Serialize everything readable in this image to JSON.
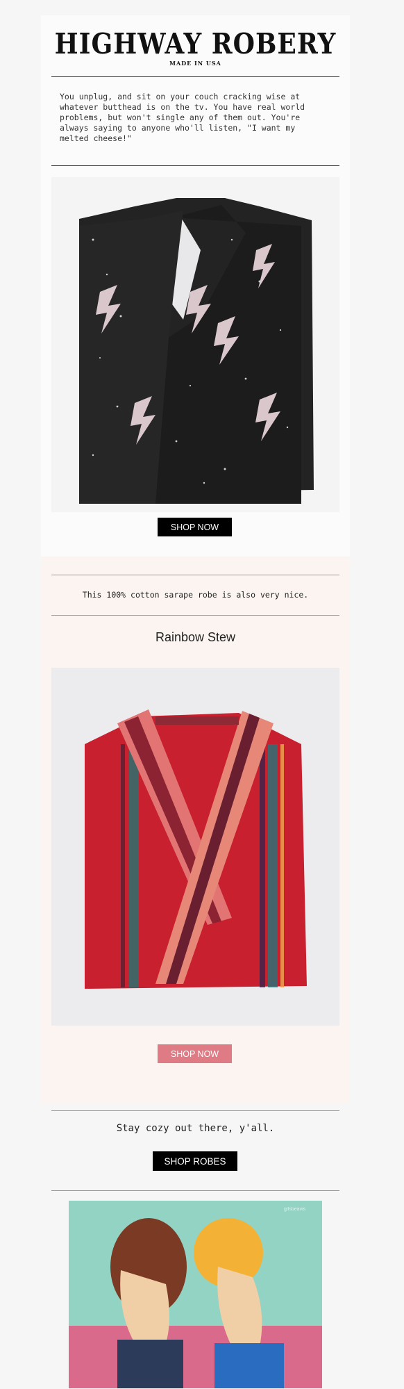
{
  "brand": {
    "name": "HIGHWAY ROBERY",
    "tagline": "MADE IN USA"
  },
  "intro": {
    "text": "You unplug, and sit on your couch cracking wise at whatever butthead is on the tv. You have real world problems, but won't single any of them out. You're always saying to anyone who'll listen, \"I want my melted cheese!\""
  },
  "section1": {
    "button_label": "SHOP NOW"
  },
  "section2": {
    "note": "This 100% cotton sarape robe is also very nice.",
    "product_title": "Rainbow Stew",
    "button_label": "SHOP NOW"
  },
  "section3": {
    "closing": "Stay cozy out there, y'all.",
    "button_label": "SHOP ROBES",
    "gif_credit": "gifsbeavis"
  },
  "colors": {
    "pink_button": "#de7b84",
    "black_button": "#000000",
    "cream_background": "#fbf4f0"
  }
}
